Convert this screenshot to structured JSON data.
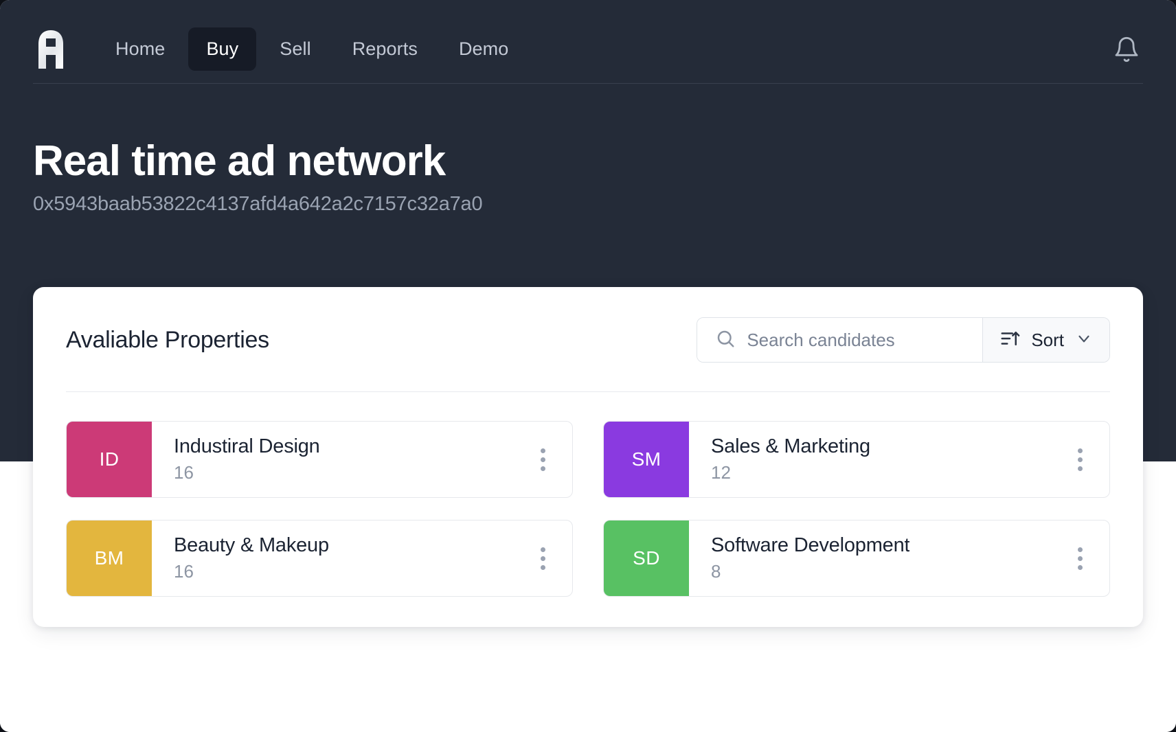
{
  "nav": {
    "logo_icon": "app-logo-a-icon",
    "links": [
      {
        "label": "Home",
        "active": false
      },
      {
        "label": "Buy",
        "active": true
      },
      {
        "label": "Sell",
        "active": false
      },
      {
        "label": "Reports",
        "active": false
      },
      {
        "label": "Demo",
        "active": false
      }
    ],
    "notification_icon": "bell-icon"
  },
  "hero": {
    "title": "Real time ad network",
    "address": "0x5943baab53822c4137afd4a642a2c7157c32a7a0"
  },
  "panel": {
    "title": "Avaliable Properties",
    "search": {
      "placeholder": "Search candidates",
      "value": "",
      "icon": "search-icon"
    },
    "sort": {
      "label": "Sort",
      "icon": "sort-ascending-icon",
      "chevron": "chevron-down-icon"
    },
    "properties": [
      {
        "initials": "ID",
        "name": "Industiral Design",
        "count": "16",
        "color": "#cc3a77"
      },
      {
        "initials": "SM",
        "name": "Sales & Marketing",
        "count": "12",
        "color": "#8a3ae0"
      },
      {
        "initials": "BM",
        "name": "Beauty & Makeup",
        "count": "16",
        "color": "#e3b63e"
      },
      {
        "initials": "SD",
        "name": "Software Development",
        "count": "8",
        "color": "#58c163"
      }
    ]
  },
  "colors": {
    "hero_background": "#242b38",
    "nav_active_background": "#161b26",
    "page_background": "#ffffff",
    "text_primary": "#1b2332",
    "text_muted": "#8d95a3"
  }
}
